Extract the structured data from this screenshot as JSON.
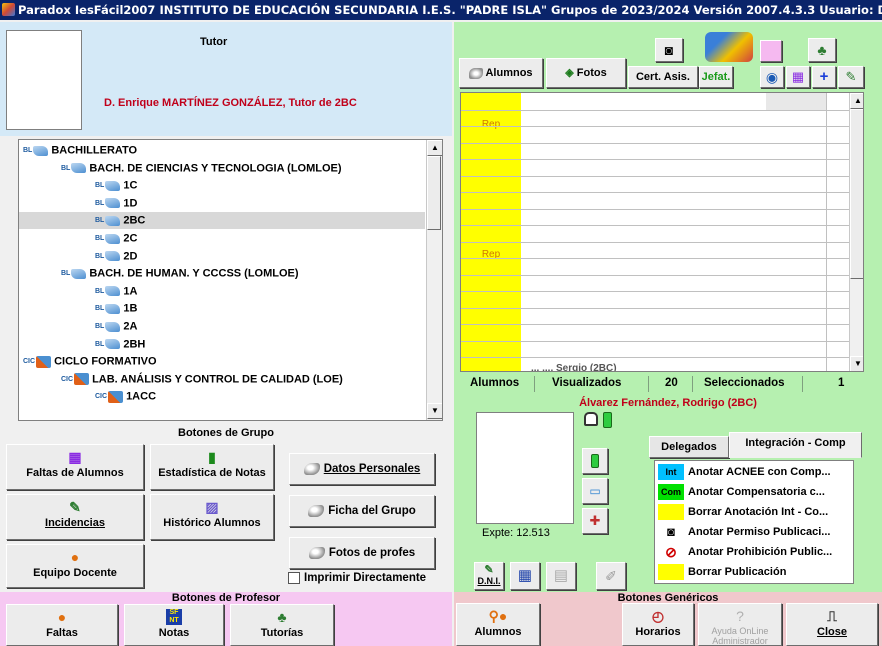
{
  "window": {
    "title": "Paradox IesFácil2007 INSTITUTO DE EDUCACIÓN SECUNDARIA I.E.S. \"PADRE ISLA\" Grupos de 2023/2024 Versión 2007.4.3.3   Usuario: DIREC"
  },
  "tutor": {
    "title": "Tutor",
    "name": "D. Enrique MARTÍNEZ GONZÁLEZ, Tutor de 2BC"
  },
  "tree": {
    "rows": [
      {
        "tag": "BL",
        "icon": "pencil-icon",
        "label": "BACHILLERATO",
        "level": 0,
        "selected": false
      },
      {
        "tag": "BL",
        "icon": "pencil-icon",
        "label": "BACH. DE CIENCIAS Y TECNOLOGIA (LOMLOE)",
        "level": 1,
        "selected": false
      },
      {
        "tag": "BL",
        "icon": "pencil-icon",
        "label": "1C",
        "level": 2,
        "selected": false
      },
      {
        "tag": "BL",
        "icon": "pencil-icon",
        "label": "1D",
        "level": 2,
        "selected": false
      },
      {
        "tag": "BL",
        "icon": "pencil-icon",
        "label": "2BC",
        "level": 2,
        "selected": true
      },
      {
        "tag": "BL",
        "icon": "pencil-icon",
        "label": "2C",
        "level": 2,
        "selected": false
      },
      {
        "tag": "BL",
        "icon": "pencil-icon",
        "label": "2D",
        "level": 2,
        "selected": false
      },
      {
        "tag": "BL",
        "icon": "pencil-icon",
        "label": "BACH. DE HUMAN. Y CCCSS (LOMLOE)",
        "level": 1,
        "selected": false
      },
      {
        "tag": "BL",
        "icon": "pencil-icon",
        "label": "1A",
        "level": 2,
        "selected": false
      },
      {
        "tag": "BL",
        "icon": "pencil-icon",
        "label": "1B",
        "level": 2,
        "selected": false
      },
      {
        "tag": "BL",
        "icon": "pencil-icon",
        "label": "2A",
        "level": 2,
        "selected": false
      },
      {
        "tag": "BL",
        "icon": "pencil-icon",
        "label": "2BH",
        "level": 2,
        "selected": false
      },
      {
        "tag": "CIC",
        "icon": "wrench-icon",
        "label": "CICLO FORMATIVO",
        "level": 0,
        "selected": false
      },
      {
        "tag": "CIC",
        "icon": "wrench-icon",
        "label": "LAB. ANÁLISIS Y CONTROL DE CALIDAD (LOE)",
        "level": 1,
        "selected": false
      },
      {
        "tag": "CIC",
        "icon": "wrench-icon",
        "label": "1ACC",
        "level": 2,
        "selected": false
      }
    ]
  },
  "group_buttons": {
    "title": "Botones de Grupo",
    "faltas_alumnos": "Faltas de Alumnos",
    "estadistica_notas": "Estadística de Notas",
    "incidencias": "Incidencias",
    "historico_alumnos": "Histórico Alumnos",
    "equipo_docente": "Equipo Docente",
    "datos_personales": "Datos Personales",
    "ficha_grupo": "Ficha del Grupo",
    "fotos_profes": "Fotos de profes",
    "imprimir_directamente": "Imprimir Directamente"
  },
  "profesor_buttons": {
    "title": "Botones de Profesor",
    "faltas": "Faltas",
    "notas": "Notas",
    "notas_icon_text": "SF\nNT",
    "tutorias": "Tutorías"
  },
  "toolbar": {
    "alumnos": "Alumnos",
    "fotos": "Fotos",
    "cert_asis": "Cert. Asis.",
    "jefat": "Jefat."
  },
  "grid": {
    "rep_labels": [
      "Rep",
      "Rep"
    ],
    "partial_row_text": "... ..., Sergio (2BC)"
  },
  "stats": {
    "alumnos_label": "Alumnos",
    "visualizados_label": "Visualizados",
    "visualizados_count": "20",
    "seleccionados_label": "Seleccionados",
    "seleccionados_count": "1"
  },
  "student": {
    "name": "Álvarez Fernández, Rodrigo  (2BC)",
    "expte": "Expte: 12.513"
  },
  "tabs": {
    "delegados": "Delegados",
    "integracion": "Integración - Comp"
  },
  "menu_items": [
    {
      "tag": "Int",
      "tag_color": "#00c0ff",
      "label": "Anotar ACNEE con Comp..."
    },
    {
      "tag": "Com",
      "tag_color": "#00e000",
      "label": "Anotar Compensatoria c..."
    },
    {
      "tag": "",
      "tag_color": "#ffff00",
      "label": "Borrar Anotación Int - Co..."
    },
    {
      "tag": "camera",
      "tag_color": "#ffffff",
      "label": "Anotar Permiso Publicaci..."
    },
    {
      "tag": "no-camera",
      "tag_color": "#ffffff",
      "label": "Anotar Prohibición Public..."
    },
    {
      "tag": "",
      "tag_color": "#ffff00",
      "label": "Borrar Publicación"
    }
  ],
  "dni_button": "D.N.I.",
  "generic_buttons": {
    "title": "Botones Genéricos",
    "alumnos": "Alumnos",
    "horarios": "Horarios",
    "ayuda_online": "Ayuda OnLine Administrador",
    "close": "Close"
  }
}
